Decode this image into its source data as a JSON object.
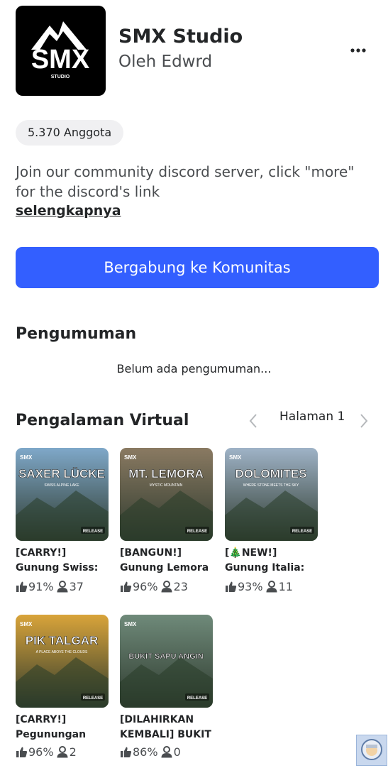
{
  "group": {
    "logo_text": "SMX",
    "logo_subtext": "STUDIO",
    "name": "SMX Studio",
    "owner": "Oleh Edwrd",
    "menu_icon": "ellipsis-icon",
    "members": "5.370 Anggota",
    "description": "Join our community discord server, click \"more\" for the discord's link",
    "more_label": "selengkapnya",
    "join_label": "Bergabung ke Komunitas"
  },
  "announcements": {
    "heading": "Pengumuman",
    "empty_text": "Belum ada pengumuman..."
  },
  "experiences": {
    "heading": "Pengalaman Virtual",
    "page_label": "Halaman 1",
    "items": [
      {
        "title": "[CARRY!] Gunung Swiss: Saxer Lücke",
        "thumb_title": "SAXER LÜCKE",
        "thumb_sub": "SWISS ALPINE LAKE",
        "badge": "RELEASE",
        "rating": "91%",
        "players": "37",
        "accent": "#7fa8c9"
      },
      {
        "title": "[BANGUN!] Gunung Lemora",
        "thumb_title": "MT. LEMORA",
        "thumb_sub": "MYSTIC MOUNTAIN",
        "badge": "RELEASE",
        "rating": "96%",
        "players": "23",
        "accent": "#8a7a62"
      },
      {
        "title": "[🎄NEW!] Gunung Italia: Dolomites",
        "thumb_title": "DOLOMITES",
        "thumb_sub": "WHERE STONE MEETS THE SKY",
        "badge": "RELEASE",
        "rating": "93%",
        "players": "11",
        "accent": "#9fb3c7"
      },
      {
        "title": "[CARRY!] Pegunungan Kazakhstan: Pik Talgar",
        "thumb_title": "PIK TALGAR",
        "thumb_sub": "A PLACE ABOVE THE CLOUDS",
        "badge": "RELEASE",
        "rating": "96%",
        "players": "2",
        "accent": "#d9a43a"
      },
      {
        "title": "[DILAHIRKAN KEMBALI] BUKIT SAPU ANGIN",
        "thumb_title": "BUKIT SAPU ANGIN",
        "thumb_sub": "",
        "badge": "RELEASE",
        "rating": "86%",
        "players": "0",
        "accent": "#6f8a7a"
      }
    ]
  }
}
